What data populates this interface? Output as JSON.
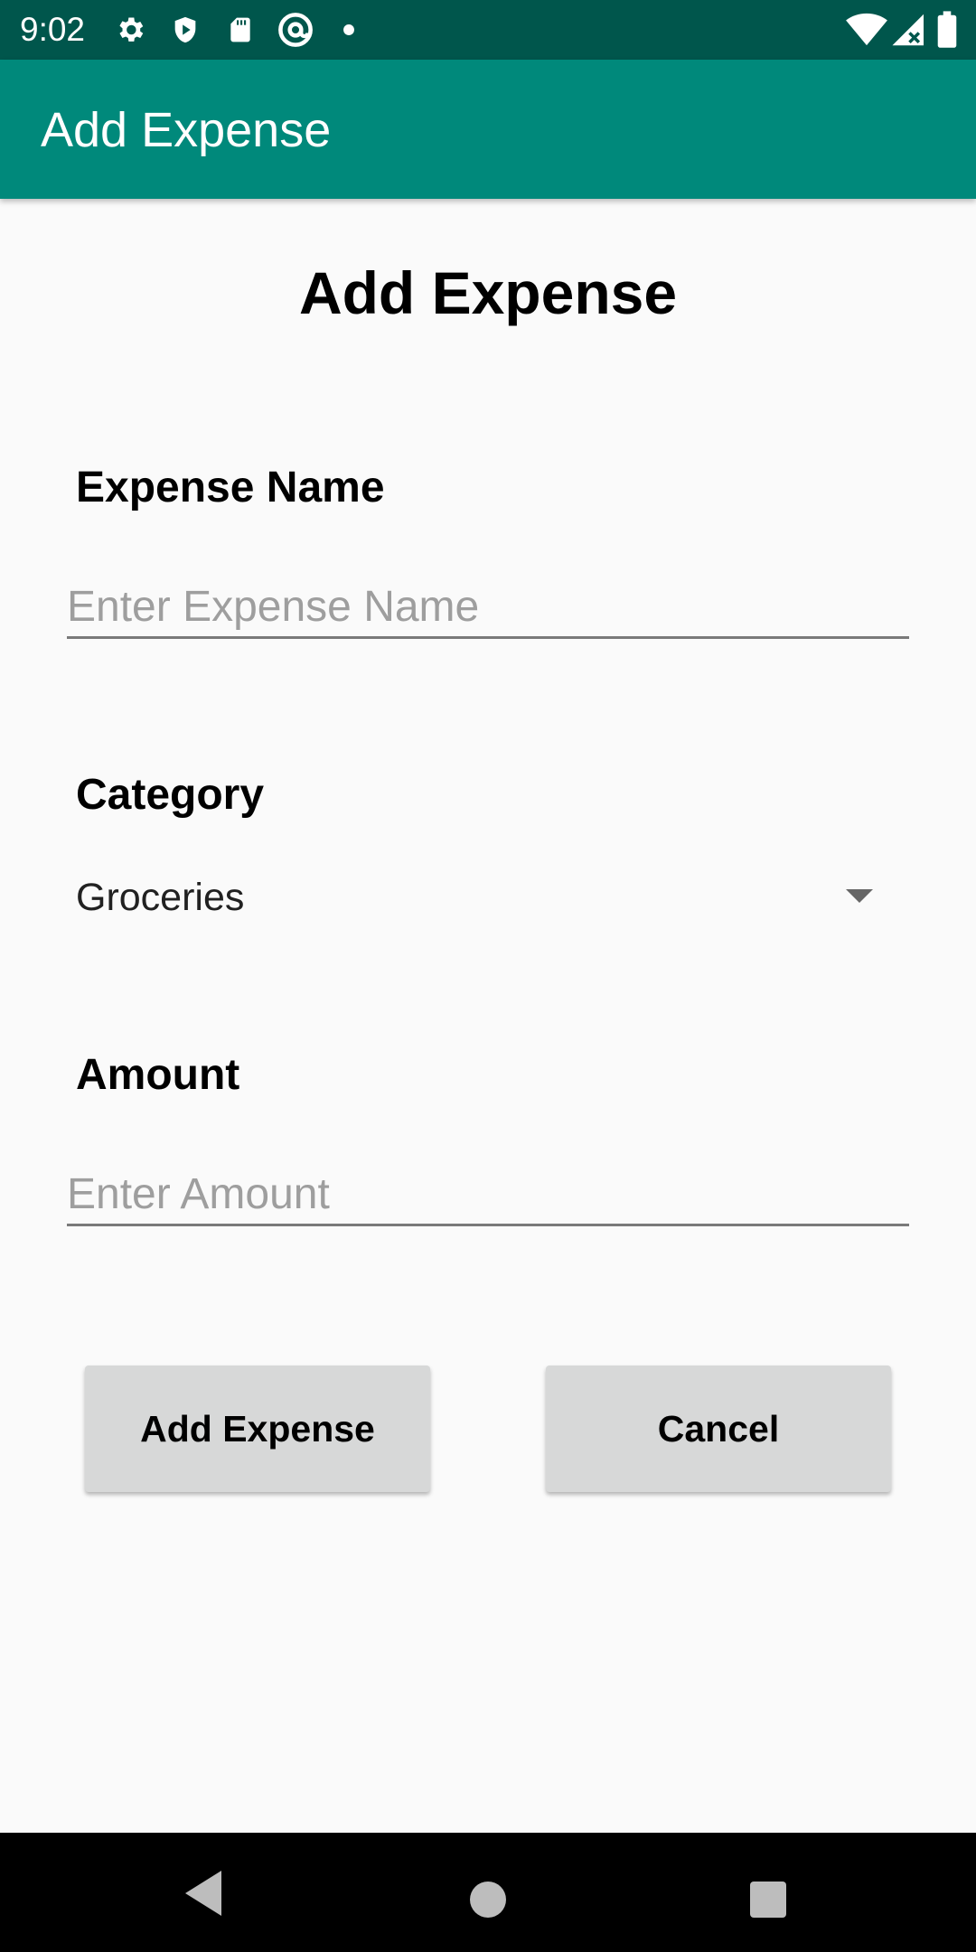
{
  "status_bar": {
    "time": "9:02",
    "left_icons": [
      "gear-icon",
      "shield-icon",
      "sd-card-icon",
      "at-sign-icon",
      "dot-icon"
    ],
    "right_icons": [
      "wifi-icon",
      "signal-icon",
      "battery-icon"
    ],
    "background_color": "#00564c"
  },
  "app_bar": {
    "title": "Add Expense",
    "background_color": "#00897b"
  },
  "form": {
    "heading": "Add Expense",
    "expense_name": {
      "label": "Expense Name",
      "value": "",
      "placeholder": "Enter Expense Name"
    },
    "category": {
      "label": "Category",
      "selected": "Groceries"
    },
    "amount": {
      "label": "Amount",
      "value": "",
      "placeholder": "Enter Amount"
    },
    "buttons": {
      "add_label": "Add Expense",
      "cancel_label": "Cancel"
    }
  },
  "nav_bar": {
    "icons": [
      "back-icon",
      "home-icon",
      "recents-icon"
    ]
  }
}
